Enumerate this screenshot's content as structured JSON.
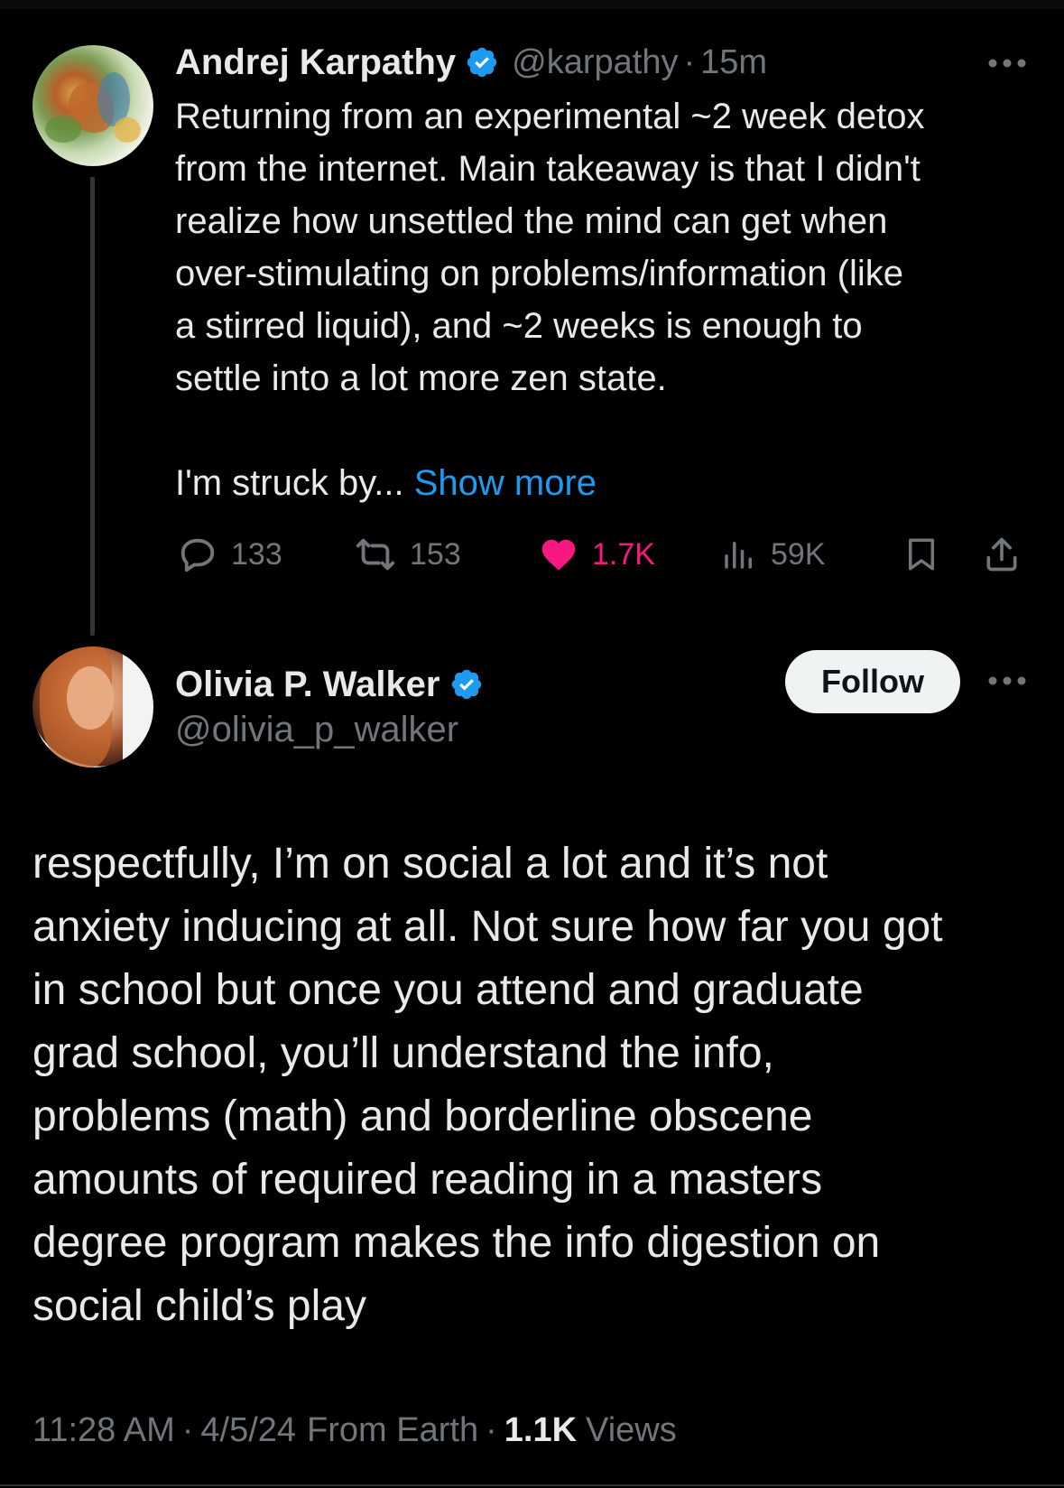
{
  "parent_tweet": {
    "display_name": "Andrej Karpathy",
    "handle": "@karpathy",
    "separator": "·",
    "time": "15m",
    "body": "Returning from an experimental ~2 week detox\nfrom the internet. Main takeaway is that I didn't\nrealize how unsettled the mind can get when\nover-stimulating on problems/information (like\na stirred liquid), and ~2 weeks is enough to\nsettle into a lot more zen state.",
    "continuation": "I'm struck by...",
    "show_more": "Show more",
    "actions": {
      "replies": "133",
      "reposts": "153",
      "likes": "1.7K",
      "views": "59K"
    }
  },
  "reply_tweet": {
    "display_name": "Olivia P. Walker",
    "handle": "@olivia_p_walker",
    "follow_label": "Follow",
    "body": "respectfully, I’m on social a lot and it’s not\nanxiety inducing at all. Not sure how far you got\nin school but once you attend and graduate\ngrad school, you’ll understand the info,\nproblems (math) and borderline obscene\namounts of required reading in a masters\ndegree program makes the info digestion on\nsocial child’s play",
    "time": "11:28 AM",
    "separator": "·",
    "date": "4/5/24",
    "source": "From Earth",
    "views_count": "1.1K",
    "views_label": "Views"
  },
  "colors": {
    "background": "#000000",
    "text_primary": "#e7e9ea",
    "text_secondary": "#71767b",
    "accent_blue": "#1d9bf0",
    "like_pink": "#f91880",
    "follow_bg": "#eff3f4"
  },
  "icons": [
    "verified-badge-icon",
    "more-options-icon",
    "reply-icon",
    "repost-icon",
    "like-heart-icon",
    "views-icon",
    "bookmark-icon",
    "share-icon"
  ]
}
